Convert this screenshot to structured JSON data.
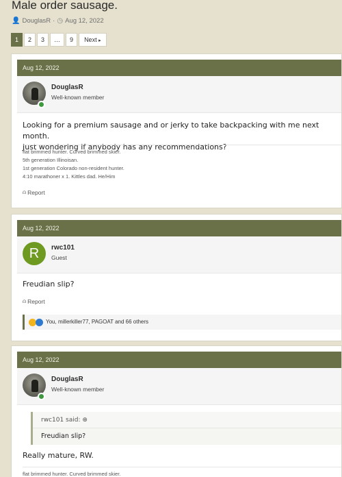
{
  "thread": {
    "title": "Male order sausage.",
    "author": "DouglasR",
    "date": "Aug 12, 2022"
  },
  "pagination": {
    "pages": [
      "1",
      "2",
      "3",
      "…",
      "9"
    ],
    "current": "1",
    "next_label": "Next"
  },
  "posts": [
    {
      "date": "Aug 12, 2022",
      "username": "DouglasR",
      "user_title": "Well-known member",
      "avatar_type": "photo",
      "message": [
        "Looking for a premium sausage and or jerky to take backpacking with me next month.",
        "Just wondering if anybody has any recommendations?"
      ],
      "signature": [
        "flat brimmed hunter. Curved brimmed skier.",
        "5th generation Illinoisan.",
        "1st generation Colorado non-resident hunter.",
        "4:10 marathoner x 1. Kittles dad. He/Him"
      ],
      "report_label": "Report"
    },
    {
      "date": "Aug 12, 2022",
      "username": "rwc101",
      "user_title": "Guest",
      "avatar_type": "letter",
      "avatar_letter": "R",
      "avatar_color": "#6f9a22",
      "message": [
        "Freudian slip?"
      ],
      "report_label": "Report",
      "reactions_text": "You, millerkiller77, PAGOAT and 66 others"
    },
    {
      "date": "Aug 12, 2022",
      "username": "DouglasR",
      "user_title": "Well-known member",
      "avatar_type": "photo",
      "quote_author": "rwc101 said:",
      "quote_text": "Freudian slip?",
      "message": [
        "Really mature, RW."
      ],
      "signature": [
        "flat brimmed hunter. Curved brimmed skier."
      ]
    }
  ],
  "colors": {
    "accent": "#6a7148",
    "background": "#e3dfcc",
    "online": "#3f9a3f"
  }
}
